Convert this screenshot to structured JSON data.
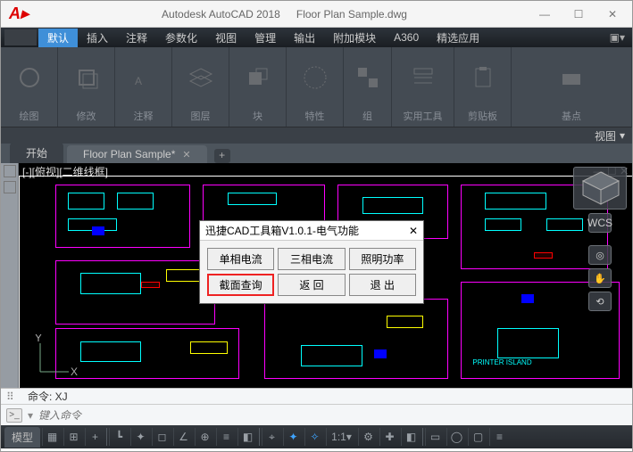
{
  "title": {
    "app": "Autodesk AutoCAD 2018",
    "doc": "Floor Plan Sample.dwg"
  },
  "menu": {
    "items": [
      "默认",
      "插入",
      "注释",
      "参数化",
      "视图",
      "管理",
      "输出",
      "附加模块",
      "A360",
      "精选应用"
    ],
    "active_index": 0
  },
  "ribbon": {
    "panels": [
      "绘图",
      "修改",
      "注释",
      "图层",
      "块",
      "特性",
      "组",
      "实用工具",
      "剪贴板",
      "基点"
    ],
    "viewsel": "视图"
  },
  "tabs": {
    "items": [
      {
        "label": "开始",
        "closeable": false
      },
      {
        "label": "Floor Plan Sample*",
        "closeable": true
      }
    ],
    "active_index": 1
  },
  "canvas": {
    "viewlabel": "[-][俯视][二维线框]",
    "label_printer": "PRINTER ISLAND",
    "wcs": "WCS"
  },
  "dialog": {
    "title": "迅捷CAD工具箱V1.0.1-电气功能",
    "buttons": [
      "单相电流",
      "三相电流",
      "照明功率",
      "截面查询",
      "返  回",
      "退  出"
    ],
    "highlight_index": 3
  },
  "cmd": {
    "hist": "命令: XJ",
    "placeholder": "键入命令"
  },
  "status": {
    "model": "模型",
    "scale": "1:1"
  }
}
